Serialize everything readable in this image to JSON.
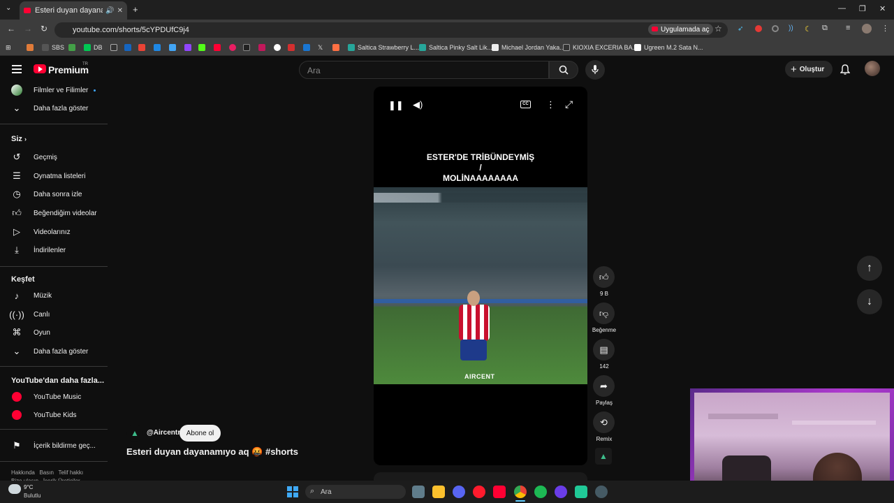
{
  "browser": {
    "tab_title": "Esteri duyan dayanamıyo a",
    "url": "youtube.com/shorts/5cYPDUfC9j4",
    "open_app_label": "Uygulamada aç",
    "bookmarks": [
      {
        "label": "SBS"
      },
      {
        "label": "DB"
      },
      {
        "label": "Saltica Strawberry L..."
      },
      {
        "label": "Saltica Pinky Salt Lik..."
      },
      {
        "label": "Michael Jordan Yaka..."
      },
      {
        "label": "KIOXIA EXCERIA BA..."
      },
      {
        "label": "Ugreen M.2 Sata N..."
      }
    ]
  },
  "header": {
    "logo_text": "Premium",
    "logo_badge": "TR",
    "search_placeholder": "Ara",
    "create_label": "Oluştur"
  },
  "sidebar": {
    "top_items": [
      {
        "label": "Filmler ve Filimler"
      },
      {
        "label": "Daha fazla göster"
      }
    ],
    "you_heading": "Siz",
    "you_items": [
      {
        "label": "Geçmiş"
      },
      {
        "label": "Oynatma listeleri"
      },
      {
        "label": "Daha sonra izle"
      },
      {
        "label": "Beğendiğim videolar"
      },
      {
        "label": "Videolarınız"
      },
      {
        "label": "İndirilenler"
      }
    ],
    "explore_heading": "Keşfet",
    "explore_items": [
      {
        "label": "Müzik"
      },
      {
        "label": "Canlı"
      },
      {
        "label": "Oyun"
      },
      {
        "label": "Daha fazla göster"
      }
    ],
    "more_heading": "YouTube'dan daha fazla...",
    "more_items": [
      {
        "label": "YouTube Music"
      },
      {
        "label": "YouTube Kids"
      }
    ],
    "report_label": "İçerik bildirme geç...",
    "footer_links": [
      "Hakkında",
      "Basın",
      "Telif hakkı"
    ],
    "footer_links2": [
      "Bize ulaşın",
      "İçerik Üreticiler"
    ]
  },
  "video": {
    "overlay_line1": "ESTER'DE TRİBÜNDEYMİŞ",
    "overlay_line2": "/",
    "overlay_line3": "MOLİNAAAAAAAA",
    "watermark": "AIRCENT",
    "channel": "@Aircentr",
    "subscribe_label": "Abone ol",
    "title": "Esteri duyan dayanamıyo aq 🤬 #shorts"
  },
  "actions": {
    "like_count": "9 B",
    "dislike_label": "Beğenme",
    "comment_count": "142",
    "share_label": "Paylaş",
    "remix_label": "Remix"
  },
  "taskbar": {
    "weather_temp": "9°C",
    "weather_desc": "Bulutlu",
    "search_label": "Ara"
  },
  "colors": {
    "yt_red": "#ff0033",
    "bg": "#0f0f0f",
    "webcam_frame": "#b03ad0"
  }
}
